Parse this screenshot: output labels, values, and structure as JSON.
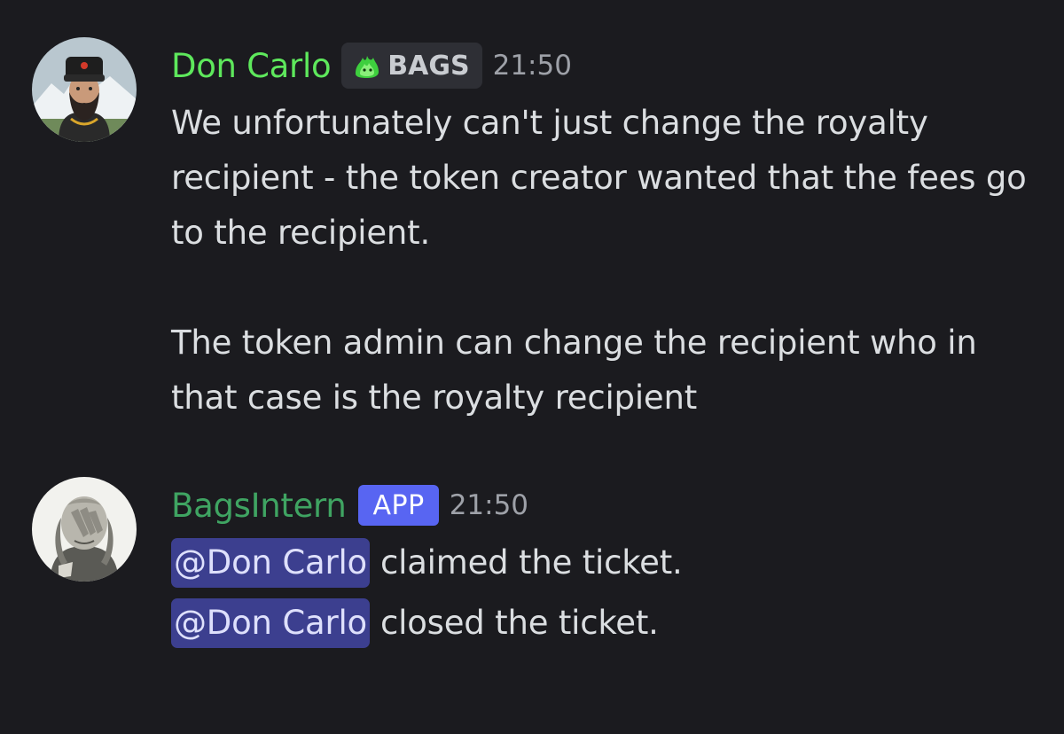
{
  "messages": [
    {
      "author": "Don Carlo",
      "author_color": "#5ee85c",
      "badge": {
        "type": "server-tag",
        "icon": "green-flame-icon",
        "label": "BAGS"
      },
      "timestamp": "21:50",
      "paragraphs": [
        "We unfortunately can't just change the royalty recipient - the token creator wanted that the fees go to the recipient.",
        "The token admin can change the recipient who in that case is the royalty recipient"
      ]
    },
    {
      "author": "BagsIntern",
      "author_color": "#3fa462",
      "badge": {
        "type": "app",
        "label": "APP"
      },
      "timestamp": "21:50",
      "lines": [
        {
          "mention": "@Don Carlo",
          "text": "claimed the ticket."
        },
        {
          "mention": "@Don Carlo",
          "text": "closed the ticket."
        }
      ]
    }
  ],
  "colors": {
    "background": "#1b1b1f",
    "mention_bg": "#3c3f8f",
    "app_badge": "#5865f2"
  }
}
